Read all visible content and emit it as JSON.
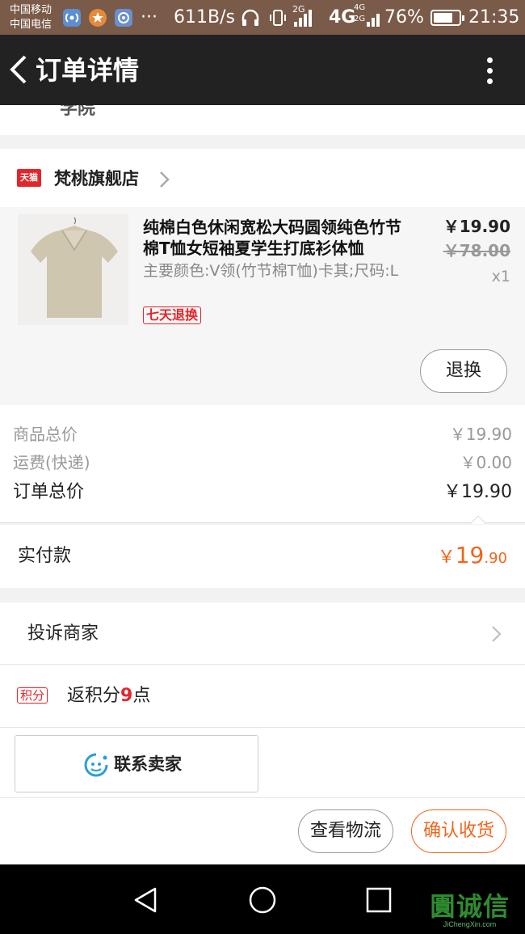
{
  "status_bar": {
    "carrier_1": "中国移动",
    "carrier_2": "中国电信",
    "overflow": "···",
    "net_speed": "611B/s",
    "net_2g": "2G",
    "net_4g": "4G",
    "net_4g_small": "4G",
    "net_2g_small": "2G",
    "battery": "76%",
    "battery_level": 0.76,
    "time": "21:35"
  },
  "header": {
    "title": "订单详情"
  },
  "address": {
    "tail_text": "学院"
  },
  "shop": {
    "badge": "天猫",
    "name": "梵桃旗舰店"
  },
  "product": {
    "title": "纯棉白色休闲宽松大码圆领纯色竹节棉T恤女短袖夏学生打底衫体恤",
    "sku": "主要颜色:V领(竹节棉T恤)卡其;尺码:L",
    "badge": "七天退换",
    "price": "￥19.90",
    "original_price": "￥78.00",
    "quantity": "x1",
    "return_button": "退换"
  },
  "totals": {
    "goods_label": "商品总价",
    "goods_value": "￥19.90",
    "shipping_label": "运费(快递)",
    "shipping_value": "￥0.00",
    "order_label": "订单总价",
    "order_value": "￥19.90",
    "paid_label": "实付款",
    "paid_currency": "￥",
    "paid_integer": "19",
    "paid_decimal": ".90"
  },
  "actions": {
    "complaint": "投诉商家",
    "points_badge": "积分",
    "points_prefix": "返积分",
    "points_value": "9",
    "points_suffix": "点",
    "contact_seller": "联系卖家",
    "view_logistics": "查看物流",
    "confirm_receipt": "确认收货"
  },
  "watermark": {
    "main": "圚诚信",
    "sub": "JiChengXin.com"
  },
  "colors": {
    "status_bar": "#7a5a48",
    "title_bar": "#222222",
    "accent_orange": "#f0651c",
    "tmall_red": "#e4262c",
    "contact_icon": "#2a9fd8"
  }
}
